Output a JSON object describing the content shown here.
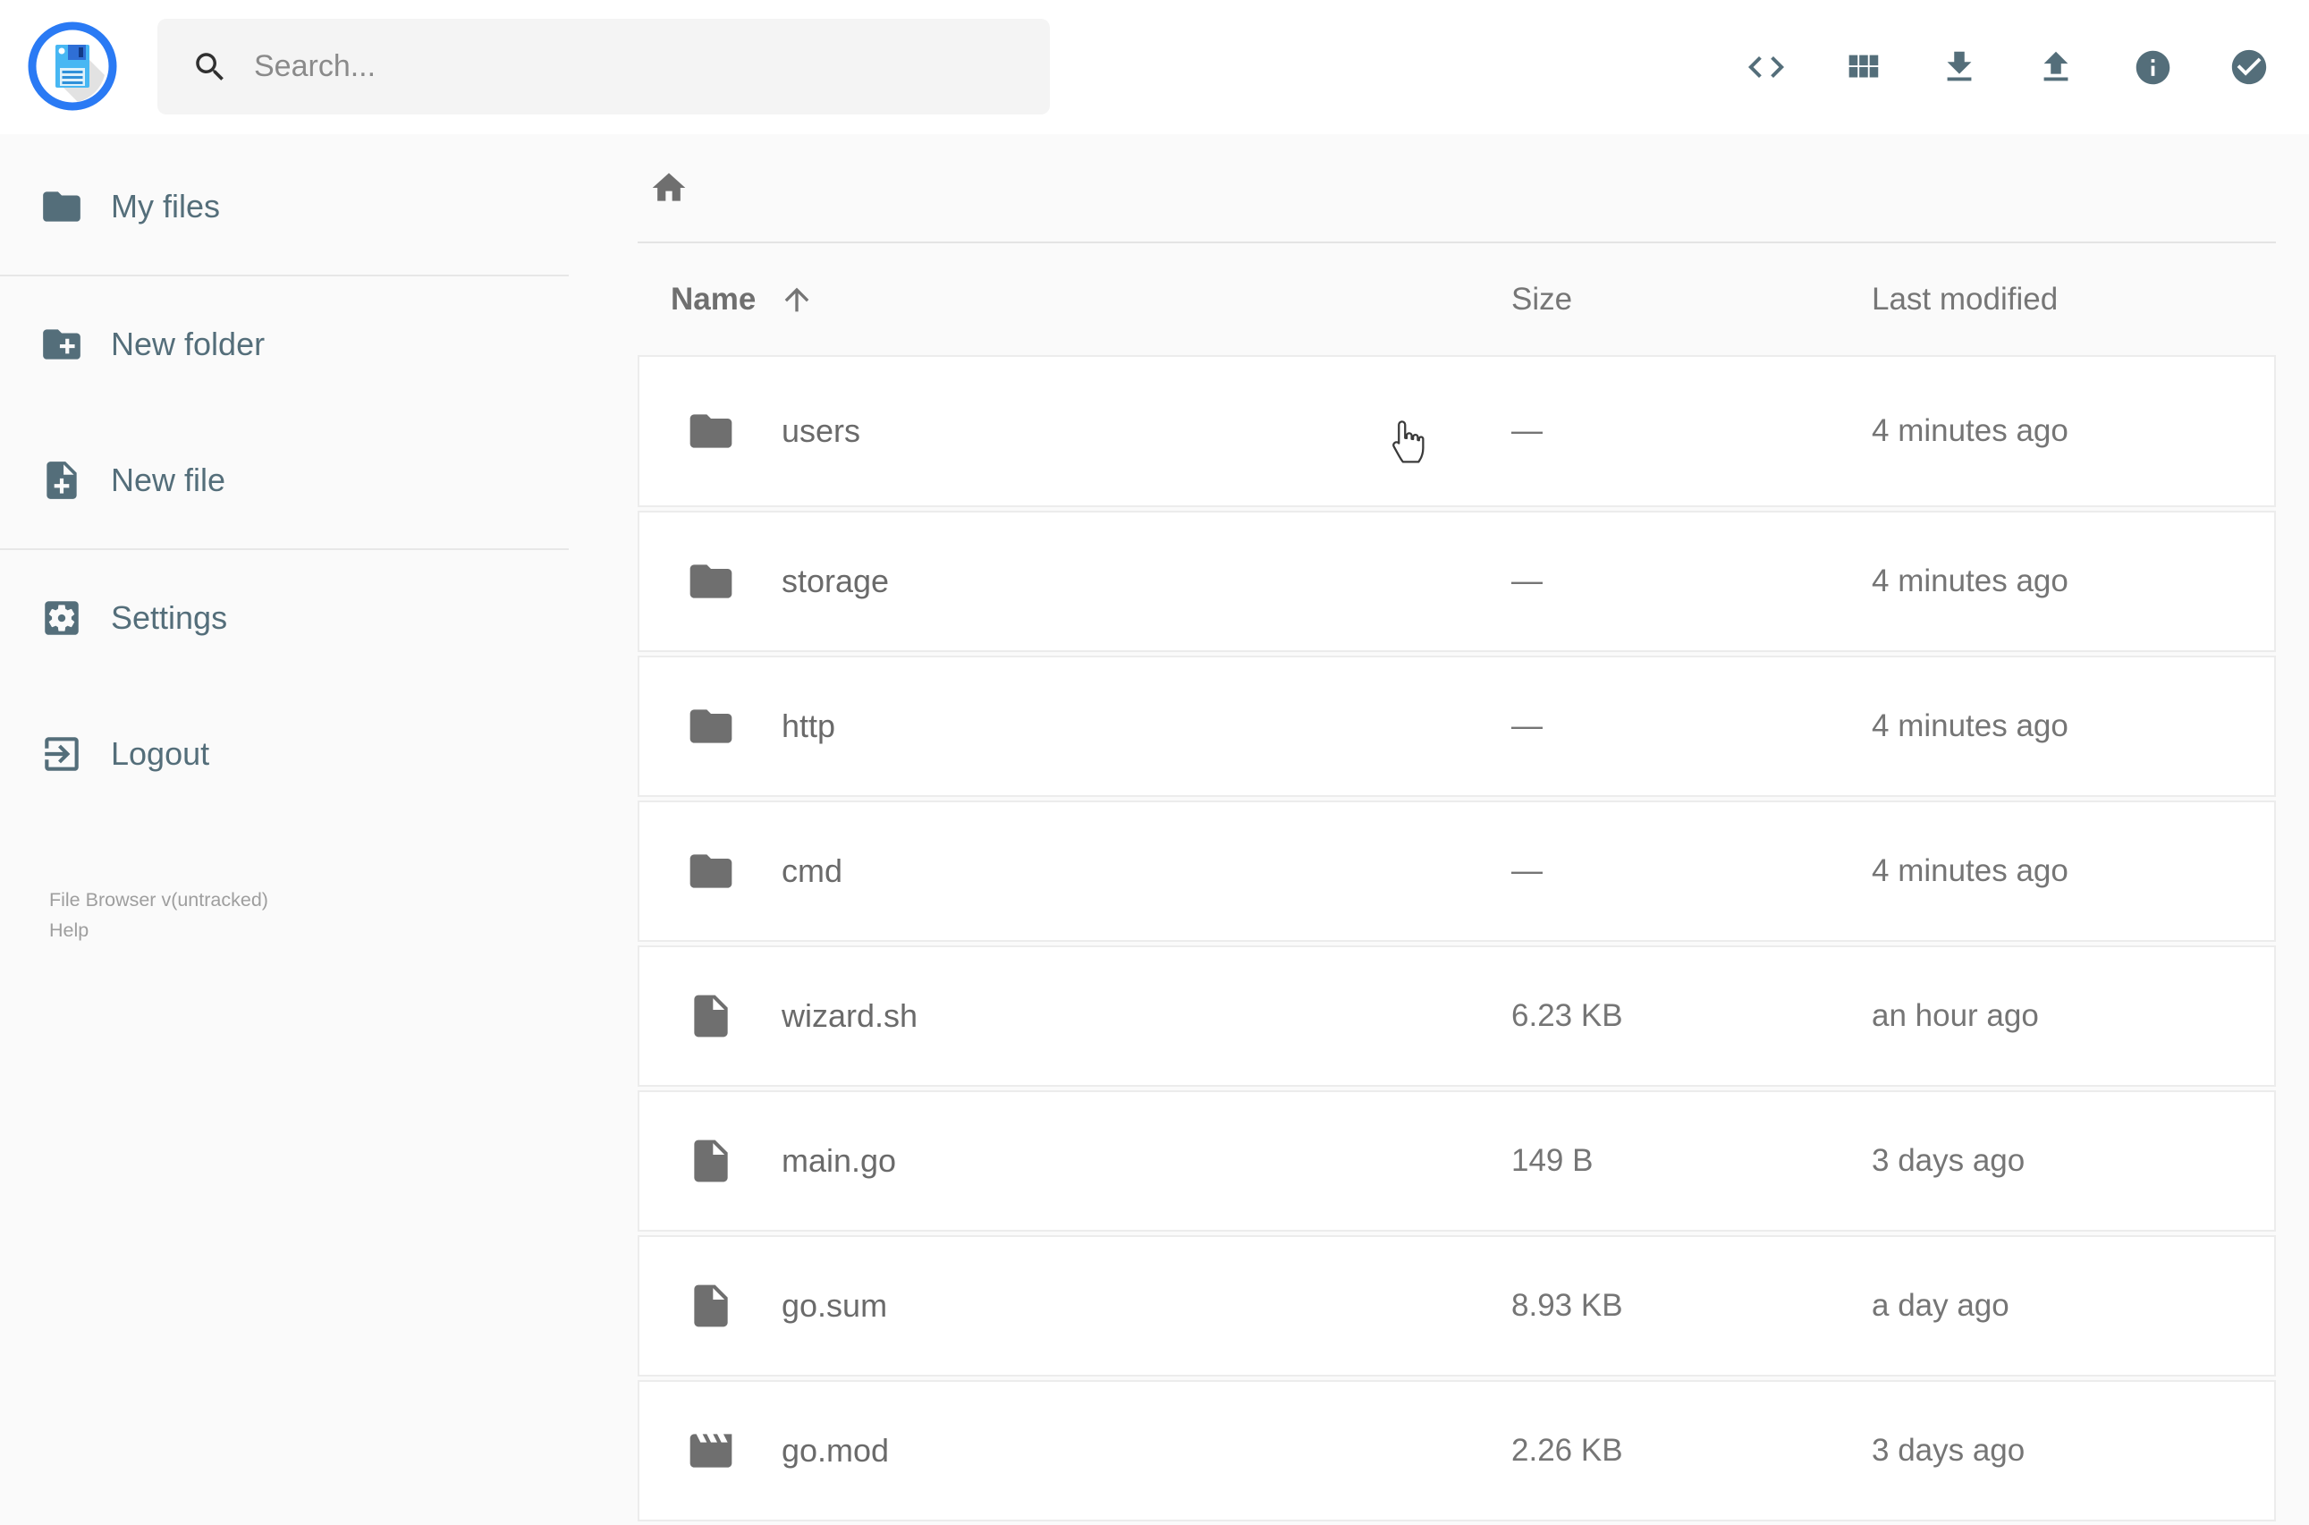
{
  "header": {
    "search_placeholder": "Search...",
    "action_icons": [
      "code-icon",
      "grid-view-icon",
      "download-icon",
      "upload-icon",
      "info-icon",
      "select-multiple-icon"
    ]
  },
  "sidebar": {
    "items": [
      {
        "label": "My files",
        "icon": "folder-icon"
      },
      {
        "label": "New folder",
        "icon": "new-folder-icon"
      },
      {
        "label": "New file",
        "icon": "new-file-icon"
      },
      {
        "label": "Settings",
        "icon": "settings-icon"
      },
      {
        "label": "Logout",
        "icon": "logout-icon"
      }
    ],
    "version_text": "File Browser v(untracked)",
    "help_label": "Help"
  },
  "listing": {
    "columns": {
      "name": "Name",
      "size": "Size",
      "modified": "Last modified"
    },
    "sort": {
      "column": "Name",
      "direction": "ascending"
    },
    "rows": [
      {
        "name": "users",
        "type": "folder",
        "size": "—",
        "modified": "4 minutes ago"
      },
      {
        "name": "storage",
        "type": "folder",
        "size": "—",
        "modified": "4 minutes ago"
      },
      {
        "name": "http",
        "type": "folder",
        "size": "—",
        "modified": "4 minutes ago"
      },
      {
        "name": "cmd",
        "type": "folder",
        "size": "—",
        "modified": "4 minutes ago"
      },
      {
        "name": "wizard.sh",
        "type": "file",
        "size": "6.23 KB",
        "modified": "an hour ago"
      },
      {
        "name": "main.go",
        "type": "file",
        "size": "149 B",
        "modified": "3 days ago"
      },
      {
        "name": "go.sum",
        "type": "file",
        "size": "8.93 KB",
        "modified": "a day ago"
      },
      {
        "name": "go.mod",
        "type": "video",
        "size": "2.26 KB",
        "modified": "3 days ago"
      }
    ]
  },
  "colors": {
    "accent_slate": "#546e7a",
    "logo_blue": "#2a7af4",
    "floppy_blue": "#47b7f3",
    "topbar_bg": "#ffffff",
    "page_bg": "#fafafa",
    "search_bg": "#f4f4f4",
    "row_bg": "#ffffff",
    "row_border": "#ececec",
    "text_gray": "#6a6a6a",
    "muted_gray": "#757575"
  }
}
